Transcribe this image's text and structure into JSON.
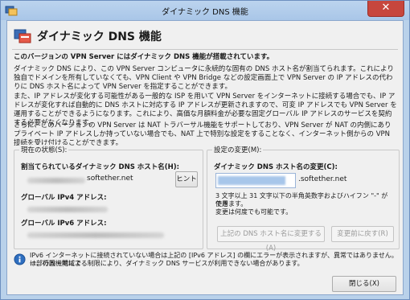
{
  "window": {
    "title": "ダイナミック DNS 機能",
    "close_glyph": "✕"
  },
  "header": {
    "title": "ダイナミック DNS 機能"
  },
  "intro": {
    "heading": "このバージョンの VPN Server にはダイナミック DNS 機能が搭載されています。",
    "p1": "ダイナミック DNS により、この VPN Server コンピュータに永続的な固有の DNS ホスト名が割当てられます。これにより独自でドメインを所有していなくても、VPN Client や VPN Bridge などの設定画面上で VPN Server の IP アドレスの代わりに DNS ホスト名によって VPN Server を指定することができます。",
    "p2": "また、IP アドレスが変化する可能性がある一般的な ISP を用いて VPN Server をインターネットに接続する場合でも、IP アドレスが変化すれば自動的に DNS ホストに対応する IP アドレスが更新されますので、可変 IP アドレスでも VPN Server を運用することができるようになります。これにより、高価な月額料金が必要な固定グローバル IP アドレスのサービスを契約する必要がなくなります。",
    "p3": "さらに、このバージョンの VPN Server は NAT トラバーサル機能をサポートしており、VPN Server が NAT の内側にありプライベート IP アドレスしか持っていない場合でも、NAT 上で特別な設定をすることなく、インターネット側からの VPN 接続を受け付けることができます。"
  },
  "current_status": {
    "group_label": "現在の状態(S):",
    "hostname_label": "割当てられているダイナミック DNS ホスト名(H):",
    "hostname_suffix": "softether.net",
    "hint_button": "ヒント",
    "ipv4_label": "グローバル IPv4 アドレス:",
    "ipv6_label": "グローバル IPv6 アドレス:"
  },
  "change_settings": {
    "group_label": "設定の変更(M):",
    "field_label": "ダイナミック DNS ホスト名の変更(C):",
    "hostname_suffix": ".softether.net",
    "help_line1": "3 文字以上 31 文字以下の半角英数字およびハイフン \"-\" が使用",
    "help_line2": "できます。",
    "help_line3": "変更は何度でも可能です。",
    "apply_button": "上記の DNS ホスト名に変更する(A)",
    "revert_button": "変更前に戻す(R)"
  },
  "footer": {
    "notice_line1": "IPv6 インターネットに接続されていない場合は上記の [IPv6 アドレス] の欄にエラーが表示されますが、異常ではありません。一部の国・地域で",
    "notice_line2": "は、行政機関による制限により、ダイナミック DNS サービスが利用できない場合があります。",
    "close_button": "閉じる(X)"
  }
}
